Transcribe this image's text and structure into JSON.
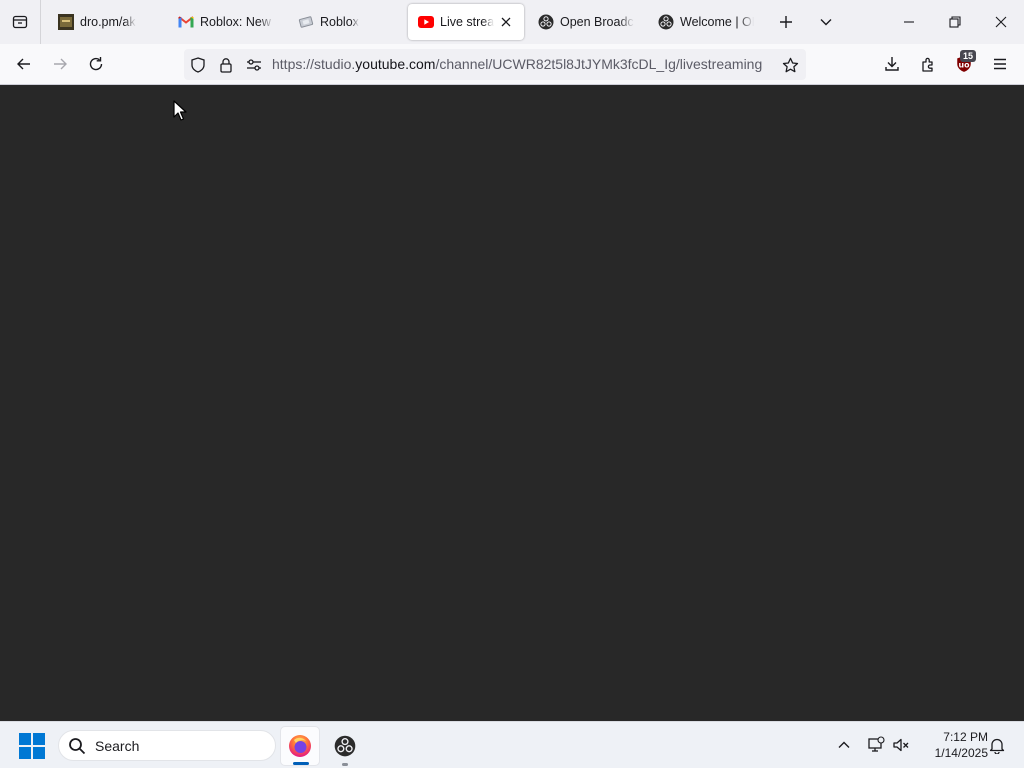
{
  "browser": {
    "tabs": [
      {
        "title": "dro.pm/ak",
        "favicon": "dro-favicon",
        "active": false
      },
      {
        "title": "Roblox: New l",
        "favicon": "gmail-icon",
        "active": false
      },
      {
        "title": "Roblox",
        "favicon": "roblox-icon",
        "active": false
      },
      {
        "title": "Live strea",
        "favicon": "youtube-icon",
        "active": true
      },
      {
        "title": "Open Broadca",
        "favicon": "obs-icon",
        "active": false
      },
      {
        "title": "Welcome | OB",
        "favicon": "obs-icon",
        "active": false
      }
    ],
    "url": {
      "prefix": "https://studio.",
      "host": "youtube.com",
      "path": "/channel/UCWR82t5l8JtJYMk3fcDL_Ig/livestreaming"
    },
    "extension_badge": "15",
    "colors": {
      "accent": "#005fb8",
      "youtube_red": "#ff0000",
      "content_bg": "#282828",
      "ublock_red": "#800000"
    }
  },
  "taskbar": {
    "search_label": "Search",
    "time": "7:12 PM",
    "date": "1/14/2025",
    "apps": [
      "firefox-icon",
      "obs-icon"
    ]
  }
}
